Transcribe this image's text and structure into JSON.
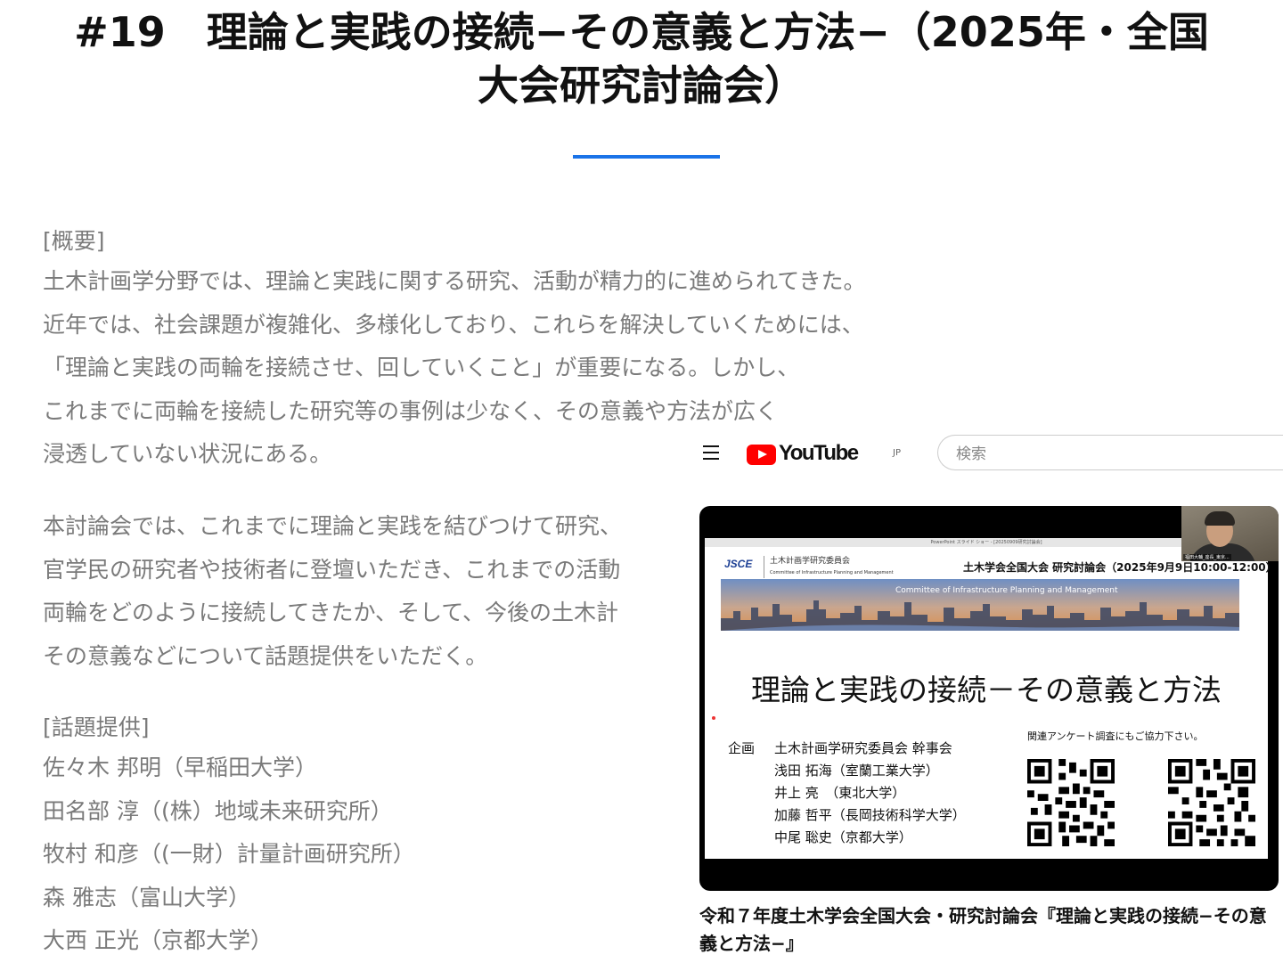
{
  "page": {
    "title_line1": "#19　理論と実践の接続−その意義と方法−（2025年・全国",
    "title_line2": "大会研究討論会）"
  },
  "overview": {
    "heading": "[概要]",
    "para1": [
      "土木計画学分野では、理論と実践に関する研究、活動が精力的に進められてきた。",
      "近年では、社会課題が複雑化、多様化しており、これらを解決していくためには、",
      "「理論と実践の両輪を接続させ、回していくこと」が重要になる。しかし、",
      "これまでに両輪を接続した研究等の事例は少なく、その意義や方法が広く",
      "浸透していない状況にある。"
    ],
    "para2": [
      "本討論会では、これまでに理論と実践を結びつけて研究、",
      "官学民の研究者や技術者に登壇いただき、これまでの活動",
      "両輪をどのように接続してきたか、そして、今後の土木計",
      "その意義などについて話題提供をいただく。"
    ]
  },
  "topics": {
    "heading": "[話題提供]",
    "speakers": [
      "佐々木 邦明（早稲田大学）",
      "田名部 淳（(株）地域未来研究所）",
      "牧村 和彦（(一財）計量計画研究所）",
      "森 雅志（富山大学）",
      "大西 正光（京都大学）"
    ]
  },
  "youtube": {
    "logo_text": "YouTube",
    "region": "JP",
    "search_placeholder": "検索",
    "video_title": "令和７年度土木学会全国大会・研究討論会『理論と実践の接続−その意義と方法−』",
    "colors": {
      "brand_red": "#ff0000",
      "accent_blue": "#1a73e8"
    }
  },
  "slide": {
    "window_caption": "PowerPoint スライド ショー - [20250909研究討論会]",
    "org_logo": "JSCE",
    "org_name": "土木計画学研究委員会",
    "org_sub": "Committee of Infrastructure Planning and Management",
    "event": "土木学会全国大会 研究討論会（2025年9月9日10:00-12:00）",
    "banner_text": "Committee of Infrastructure Planning and Management",
    "title": "理論と実践の接続－その意義と方法",
    "plan_label": "企画",
    "plan": [
      "土木計画学研究委員会 幹事会",
      "浅田 拓海（室蘭工業大学）",
      "井上 亮　（東北大学）",
      "加藤 哲平（長岡技術科学大学）",
      "中尾 聡史（京都大学）"
    ],
    "survey_note": "関連アンケート調査にもご協力下さい。",
    "webcam_name": "福田大輔_座長_東京..."
  }
}
